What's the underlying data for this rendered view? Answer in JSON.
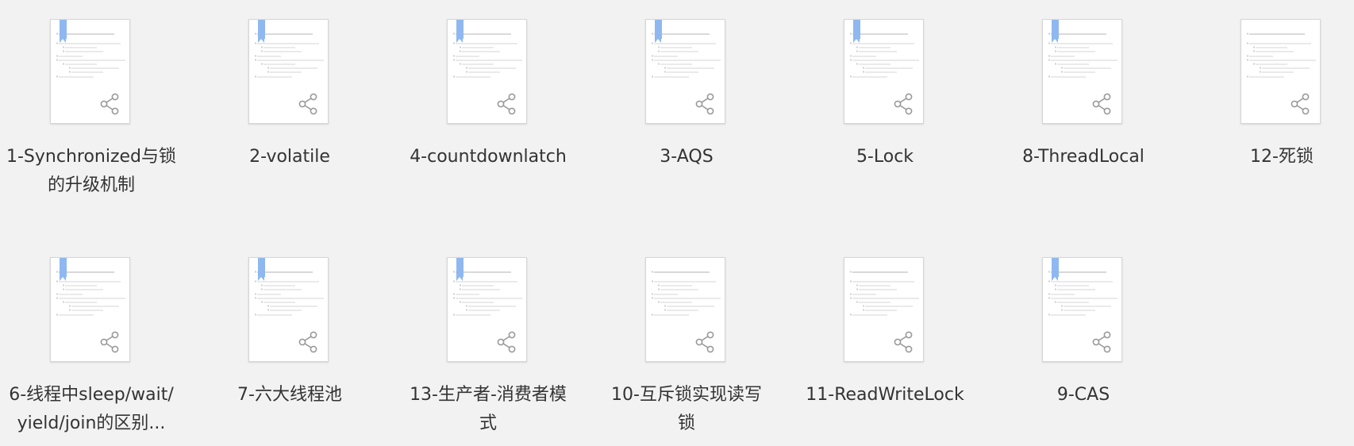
{
  "files": [
    {
      "name": "1-Synchronized与锁的升级机制",
      "label_lines": [
        "1-Synchronized与锁",
        "的升级机制"
      ],
      "bookmarked": true,
      "icon": "document-thumbnail-icon"
    },
    {
      "name": "2-volatile",
      "label_lines": [
        "2-volatile"
      ],
      "bookmarked": true,
      "icon": "document-thumbnail-icon"
    },
    {
      "name": "4-countdownlatch",
      "label_lines": [
        "4-countdownlatch"
      ],
      "bookmarked": true,
      "icon": "document-thumbnail-icon"
    },
    {
      "name": "3-AQS",
      "label_lines": [
        "3-AQS"
      ],
      "bookmarked": true,
      "icon": "document-thumbnail-icon"
    },
    {
      "name": "5-Lock",
      "label_lines": [
        "5-Lock"
      ],
      "bookmarked": true,
      "icon": "document-thumbnail-icon"
    },
    {
      "name": "8-ThreadLocal",
      "label_lines": [
        "8-ThreadLocal"
      ],
      "bookmarked": true,
      "icon": "document-thumbnail-icon"
    },
    {
      "name": "12-死锁",
      "label_lines": [
        "12-死锁"
      ],
      "bookmarked": false,
      "icon": "document-thumbnail-icon"
    },
    {
      "name": "6-线程中sleep/wait/yield/join的区别...",
      "label_lines": [
        "6-线程中sleep/wait/",
        "yield/join的区别..."
      ],
      "bookmarked": true,
      "icon": "document-thumbnail-icon"
    },
    {
      "name": "7-六大线程池",
      "label_lines": [
        "7-六大线程池"
      ],
      "bookmarked": true,
      "icon": "document-thumbnail-icon"
    },
    {
      "name": "13-生产者-消费者模式",
      "label_lines": [
        "13-生产者-消费者模",
        "式"
      ],
      "bookmarked": true,
      "icon": "document-thumbnail-icon"
    },
    {
      "name": "10-互斥锁实现读写锁",
      "label_lines": [
        "10-互斥锁实现读写",
        "锁"
      ],
      "bookmarked": false,
      "icon": "document-thumbnail-icon"
    },
    {
      "name": "11-ReadWriteLock",
      "label_lines": [
        "11-ReadWriteLock"
      ],
      "bookmarked": false,
      "icon": "document-thumbnail-icon"
    },
    {
      "name": "9-CAS",
      "label_lines": [
        "9-CAS"
      ],
      "bookmarked": true,
      "icon": "document-thumbnail-icon"
    }
  ],
  "colors": {
    "background": "#f2f2f2",
    "bookmark": "#8fb8f0",
    "label_text": "#333333",
    "share_icon": "#9a9a9a"
  }
}
